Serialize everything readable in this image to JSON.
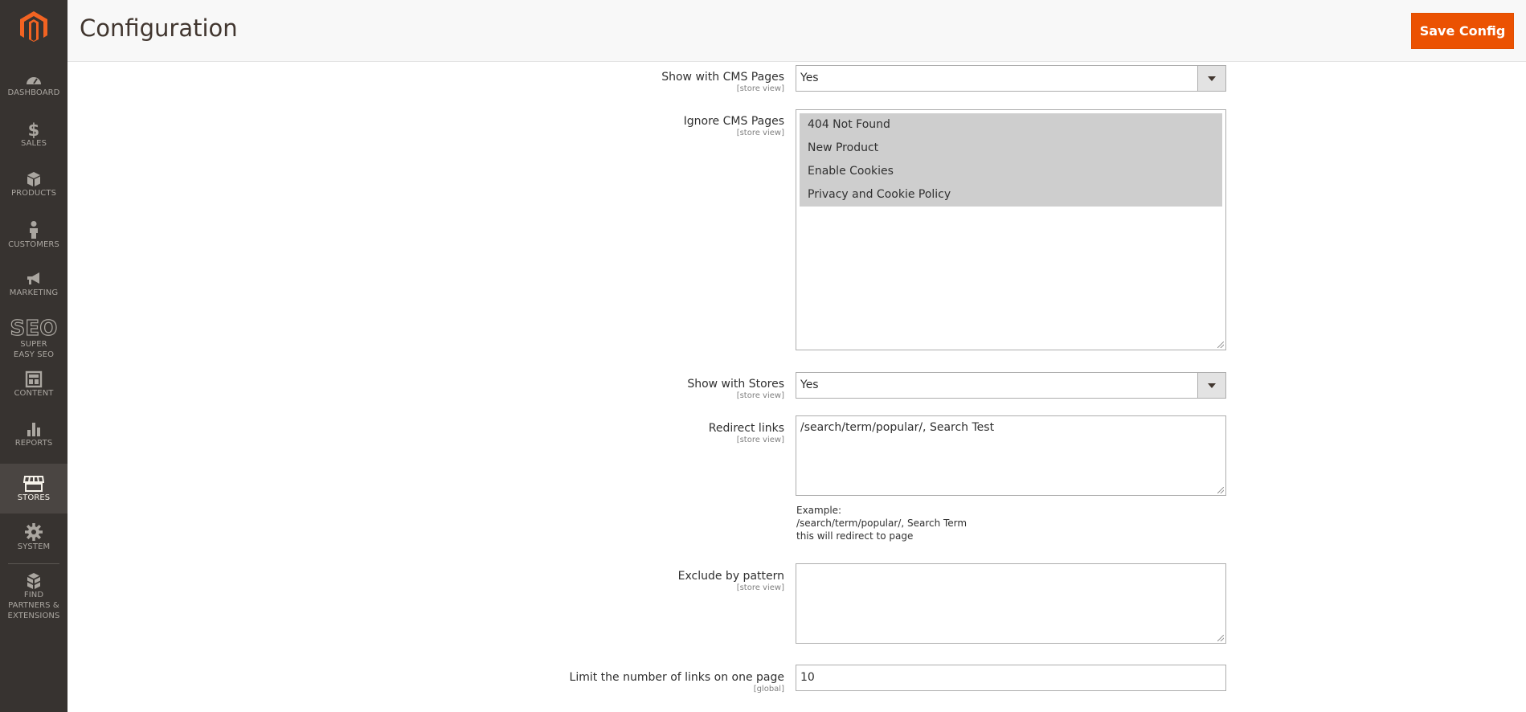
{
  "sidebar": {
    "items": [
      {
        "label": "DASHBOARD",
        "icon": "dashboard-icon"
      },
      {
        "label": "SALES",
        "icon": "dollar-icon"
      },
      {
        "label": "PRODUCTS",
        "icon": "box-icon"
      },
      {
        "label": "CUSTOMERS",
        "icon": "person-icon"
      },
      {
        "label": "MARKETING",
        "icon": "megaphone-icon"
      },
      {
        "label": "SUPER EASY SEO",
        "icon": "seo-icon"
      },
      {
        "label": "CONTENT",
        "icon": "layout-icon"
      },
      {
        "label": "REPORTS",
        "icon": "bar-chart-icon"
      },
      {
        "label": "STORES",
        "icon": "store-icon"
      },
      {
        "label": "SYSTEM",
        "icon": "gear-icon"
      },
      {
        "label": "FIND PARTNERS & EXTENSIONS",
        "icon": "cubes-icon"
      }
    ],
    "active": "STORES"
  },
  "header": {
    "title": "Configuration",
    "save_label": "Save Config"
  },
  "form": {
    "show_cms": {
      "label": "Show with CMS Pages",
      "scope": "[store view]",
      "value": "Yes"
    },
    "ignore_cms": {
      "label": "Ignore CMS Pages",
      "scope": "[store view]",
      "options": [
        "404 Not Found",
        "New Product",
        "Enable Cookies",
        "Privacy and Cookie Policy"
      ]
    },
    "show_stores": {
      "label": "Show with Stores",
      "scope": "[store view]",
      "value": "Yes"
    },
    "redirect_links": {
      "label": "Redirect links",
      "scope": "[store view]",
      "value": "/search/term/popular/, Search Test",
      "note": [
        "Example:",
        "/search/term/popular/, Search Term",
        "this will redirect to page"
      ]
    },
    "exclude_pattern": {
      "label": "Exclude by pattern",
      "scope": "[store view]",
      "value": ""
    },
    "limit_links": {
      "label": "Limit the number of links on one page",
      "scope": "[global]",
      "value": "10"
    }
  },
  "colors": {
    "accent": "#eb5202",
    "sidebar_bg": "#373330"
  }
}
